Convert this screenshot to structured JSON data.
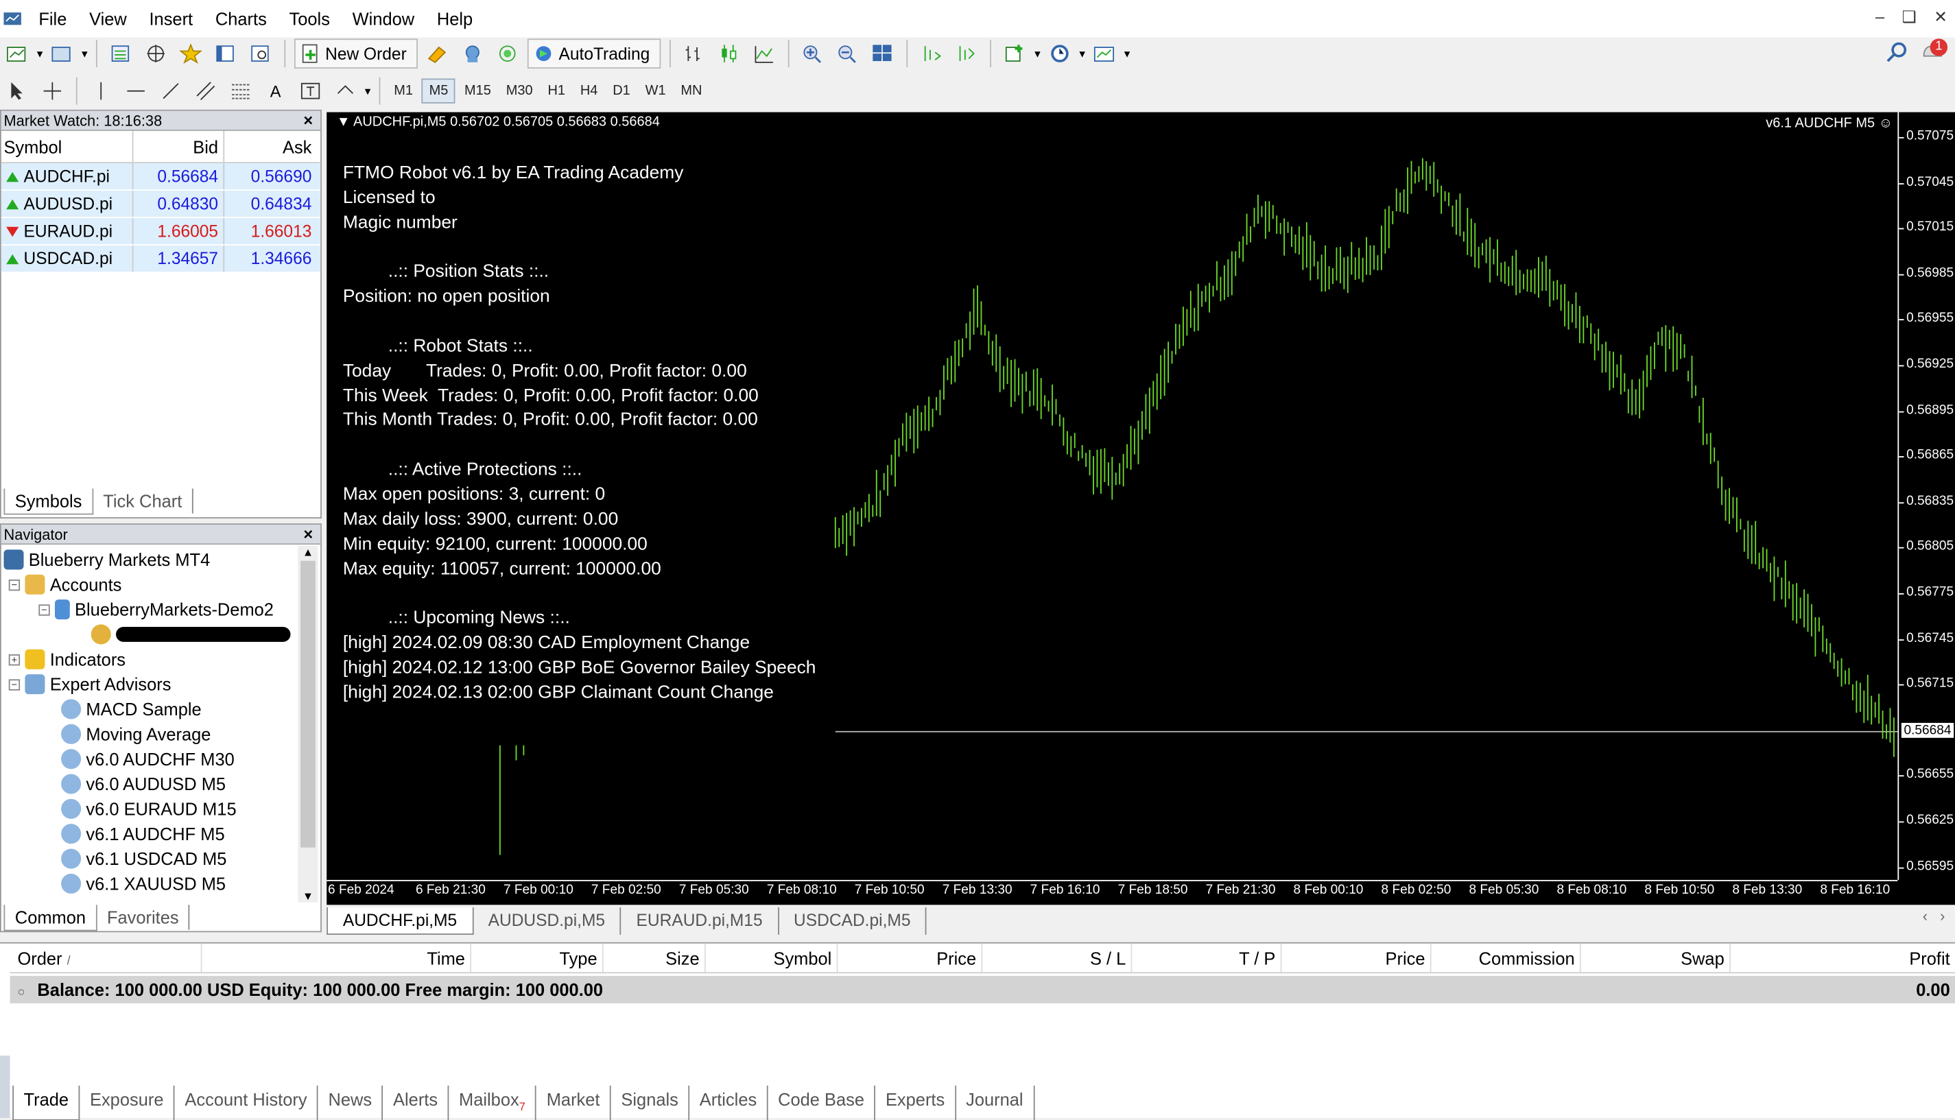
{
  "menu": [
    "File",
    "View",
    "Insert",
    "Charts",
    "Tools",
    "Window",
    "Help"
  ],
  "toolbar": {
    "new_order": "New Order",
    "autotrading": "AutoTrading",
    "timeframes": [
      "M1",
      "M5",
      "M15",
      "M30",
      "H1",
      "H4",
      "D1",
      "W1",
      "MN"
    ],
    "selected_tf": "M5",
    "notification_count": "1"
  },
  "market_watch": {
    "title": "Market Watch: 18:16:38",
    "cols": [
      "Symbol",
      "Bid",
      "Ask"
    ],
    "rows": [
      {
        "symbol": "AUDCHF.pi",
        "bid": "0.56684",
        "ask": "0.56690",
        "dir": "up",
        "color": "#1a1adb"
      },
      {
        "symbol": "AUDUSD.pi",
        "bid": "0.64830",
        "ask": "0.64834",
        "dir": "up",
        "color": "#1a1adb"
      },
      {
        "symbol": "EURAUD.pi",
        "bid": "1.66005",
        "ask": "1.66013",
        "dir": "down",
        "color": "#d61a1a"
      },
      {
        "symbol": "USDCAD.pi",
        "bid": "1.34657",
        "ask": "1.34666",
        "dir": "up",
        "color": "#1a1adb"
      }
    ],
    "tabs": [
      "Symbols",
      "Tick Chart"
    ]
  },
  "navigator": {
    "title": "Navigator",
    "root": "Blueberry Markets MT4",
    "accounts": "Accounts",
    "account_name": "BlueberryMarkets-Demo2",
    "indicators": "Indicators",
    "experts": "Expert Advisors",
    "ea_list": [
      "MACD Sample",
      "Moving Average",
      "v6.0 AUDCHF M30",
      "v6.0 AUDUSD M5",
      "v6.0 EURAUD M15",
      "v6.1 AUDCHF M5",
      "v6.1 USDCAD M5",
      "v6.1 XAUUSD M5"
    ],
    "tabs": [
      "Common",
      "Favorites"
    ]
  },
  "chart": {
    "header": "AUDCHF.pi,M5  0.56702 0.56705 0.56683 0.56684",
    "ea_label": "v6.1 AUDCHF M5",
    "info_lines": [
      "FTMO Robot v6.1 by EA Trading Academy",
      "Licensed to",
      "Magic number",
      "",
      "         ..:: Position Stats ::..",
      "Position: no open position",
      "",
      "         ..:: Robot Stats ::..",
      "Today       Trades: 0, Profit: 0.00, Profit factor: 0.00",
      "This Week  Trades: 0, Profit: 0.00, Profit factor: 0.00",
      "This Month Trades: 0, Profit: 0.00, Profit factor: 0.00",
      "",
      "         ..:: Active Protections ::..",
      "Max open positions: 3, current: 0",
      "Max daily loss: 3900, current: 0.00",
      "Min equity: 92100, current: 100000.00",
      "Max equity: 110057, current: 100000.00",
      "",
      "         ..:: Upcoming News ::..",
      "[high] 2024.02.09 08:30 CAD Employment Change",
      "[high] 2024.02.12 13:00 GBP BoE Governor Bailey Speech",
      "[high] 2024.02.13 02:00 GBP Claimant Count Change"
    ],
    "price_labels": [
      "0.57075",
      "0.57045",
      "0.57015",
      "0.56985",
      "0.56955",
      "0.56925",
      "0.56895",
      "0.56865",
      "0.56835",
      "0.56805",
      "0.56775",
      "0.56745",
      "0.56715",
      "0.56684",
      "0.56655",
      "0.56625",
      "0.56595"
    ],
    "current_price": "0.56684",
    "time_labels": [
      "6 Feb 2024",
      "6 Feb 21:30",
      "7 Feb 00:10",
      "7 Feb 02:50",
      "7 Feb 05:30",
      "7 Feb 08:10",
      "7 Feb 10:50",
      "7 Feb 13:30",
      "7 Feb 16:10",
      "7 Feb 18:50",
      "7 Feb 21:30",
      "8 Feb 00:10",
      "8 Feb 02:50",
      "8 Feb 05:30",
      "8 Feb 08:10",
      "8 Feb 10:50",
      "8 Feb 13:30",
      "8 Feb 16:10"
    ],
    "bar_color": "#6edb2a",
    "price_anchors": [
      0.56815,
      0.56823,
      0.5684,
      0.56885,
      0.5689,
      0.56925,
      0.5696,
      0.56925,
      0.5691,
      0.56905,
      0.56875,
      0.56858,
      0.56855,
      0.56882,
      0.5692,
      0.56955,
      0.56975,
      0.5699,
      0.5703,
      0.57015,
      0.57,
      0.56985,
      0.5699,
      0.56995,
      0.57035,
      0.57055,
      0.57035,
      0.57005,
      0.56995,
      0.56985,
      0.56985,
      0.56965,
      0.5695,
      0.56925,
      0.56895,
      0.56945,
      0.56935,
      0.56885,
      0.5683,
      0.56805,
      0.56785,
      0.56765,
      0.56745,
      0.5672,
      0.567,
      0.56684
    ]
  },
  "chart_tabs": [
    "AUDCHF.pi,M5",
    "AUDUSD.pi,M5",
    "EURAUD.pi,M15",
    "USDCAD.pi,M5"
  ],
  "terminal": {
    "cols": [
      "Order",
      "Time",
      "Type",
      "Size",
      "Symbol",
      "Price",
      "S / L",
      "T / P",
      "Price",
      "Commission",
      "Swap",
      "Profit"
    ],
    "balance": "Balance: 100 000.00 USD  Equity: 100 000.00  Free margin: 100 000.00",
    "profit": "0.00",
    "tabs": [
      "Trade",
      "Exposure",
      "Account History",
      "News",
      "Alerts",
      "Mailbox",
      "Market",
      "Signals",
      "Articles",
      "Code Base",
      "Experts",
      "Journal"
    ],
    "mailbox_count": "7"
  }
}
